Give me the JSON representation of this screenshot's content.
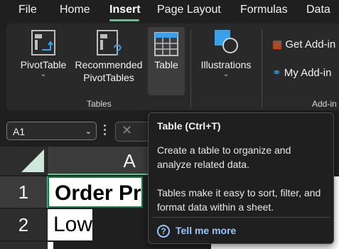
{
  "tabs": [
    "File",
    "Home",
    "Insert",
    "Page Layout",
    "Formulas",
    "Data"
  ],
  "ribbon": {
    "pivot_table": "PivotTable",
    "recommended_line1": "Recommended",
    "recommended_line2": "PivotTables",
    "table": "Table",
    "illustrations": "Illustrations",
    "tables_group": "Tables",
    "get_addins": "Get Add-in",
    "my_addins": "My Add-in",
    "addins_group": "Add-in"
  },
  "formula_bar": {
    "name_box": "A1"
  },
  "grid": {
    "column_header": "A",
    "rows": [
      {
        "number": "1",
        "value": "Order Pr"
      },
      {
        "number": "2",
        "value": "Low"
      }
    ]
  },
  "tooltip": {
    "title": "Table (Ctrl+T)",
    "para1": "Create a table to organize and analyze related data.",
    "para2": "Tables make it easy to sort, filter, and format data within a sheet.",
    "link": "Tell me more"
  },
  "colors": {
    "accent": "#5fc48b",
    "link": "#9ac4f5",
    "background": "#1f1f1f",
    "ribbon": "#292929"
  }
}
